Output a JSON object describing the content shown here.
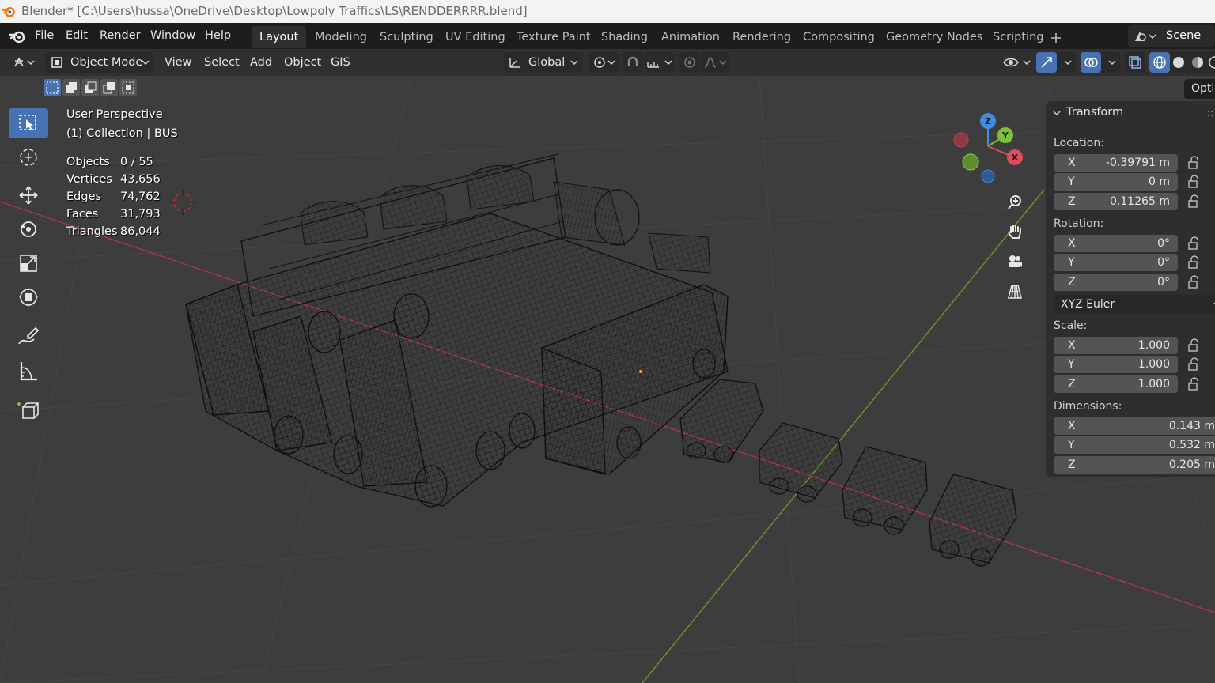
{
  "window": {
    "title": "Blender* [C:\\Users\\hussa\\OneDrive\\Desktop\\Lowpoly Traffics\\LS\\RENDDERRRR.blend]"
  },
  "menu": [
    "File",
    "Edit",
    "Render",
    "Window",
    "Help"
  ],
  "workspaces": [
    "Layout",
    "Modeling",
    "Sculpting",
    "UV Editing",
    "Texture Paint",
    "Shading",
    "Animation",
    "Rendering",
    "Compositing",
    "Geometry Nodes",
    "Scripting"
  ],
  "active_workspace": "Layout",
  "scene": {
    "label": "Scene"
  },
  "header": {
    "mode": "Object Mode",
    "menus": [
      "View",
      "Select",
      "Add",
      "Object",
      "GIS"
    ],
    "orientation": "Global"
  },
  "viewport": {
    "view_name": "User Perspective",
    "collection": "(1) Collection | BUS",
    "stats": [
      {
        "label": "Objects",
        "value": "0 / 55"
      },
      {
        "label": "Vertices",
        "value": "43,656"
      },
      {
        "label": "Edges",
        "value": "74,762"
      },
      {
        "label": "Faces",
        "value": "31,793"
      },
      {
        "label": "Triangles",
        "value": "86,044"
      }
    ],
    "gizmo": {
      "x": "X",
      "y": "Y",
      "z": "Z"
    }
  },
  "options_tab": "Optio",
  "transform_panel": {
    "title": "Transform",
    "location_label": "Location:",
    "location": [
      {
        "axis": "X",
        "value": "-0.39791 m"
      },
      {
        "axis": "Y",
        "value": "0 m"
      },
      {
        "axis": "Z",
        "value": "0.11265 m"
      }
    ],
    "rotation_label": "Rotation:",
    "rotation": [
      {
        "axis": "X",
        "value": "0°"
      },
      {
        "axis": "Y",
        "value": "0°"
      },
      {
        "axis": "Z",
        "value": "0°"
      }
    ],
    "rotation_mode": "XYZ Euler",
    "scale_label": "Scale:",
    "scale": [
      {
        "axis": "X",
        "value": "1.000"
      },
      {
        "axis": "Y",
        "value": "1.000"
      },
      {
        "axis": "Z",
        "value": "1.000"
      }
    ],
    "dimensions_label": "Dimensions:",
    "dimensions": [
      {
        "axis": "X",
        "value": "0.143 m"
      },
      {
        "axis": "Y",
        "value": "0.532 m"
      },
      {
        "axis": "Z",
        "value": "0.205 m"
      }
    ]
  },
  "colors": {
    "accent": "#4772b3",
    "x_axis": "#e24a60",
    "y_axis": "#7ec03a",
    "z_axis": "#3f8ce0"
  }
}
